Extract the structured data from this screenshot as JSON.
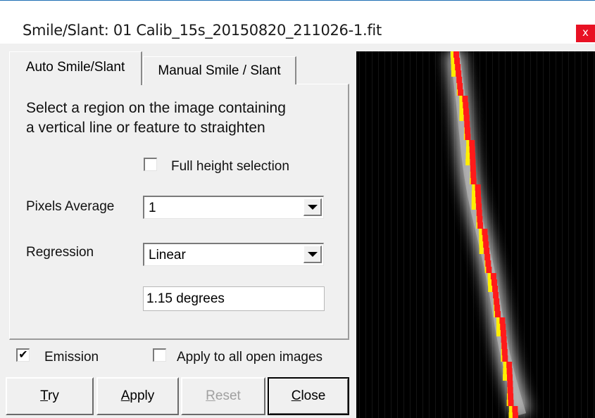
{
  "window": {
    "title": "Smile/Slant: 01 Calib_15s_20150820_211026-1.fit",
    "close_glyph": "x",
    "accent": "#e81123"
  },
  "tabs": [
    {
      "label": "Auto Smile/Slant",
      "active": true
    },
    {
      "label": "Manual Smile / Slant",
      "active": false
    }
  ],
  "instructions": {
    "line1": "Select a region on the image containing",
    "line2": "a vertical line or feature to straighten"
  },
  "full_height": {
    "label": "Full height selection",
    "checked": false
  },
  "pixels_average": {
    "label": "Pixels Average",
    "value": "1"
  },
  "regression": {
    "label": "Regression",
    "value": "Linear"
  },
  "angle": {
    "value": "1.15 degrees"
  },
  "emission": {
    "label": "Emission",
    "checked": true,
    "mark": "✔"
  },
  "apply_all": {
    "label": "Apply to all open images",
    "checked": false
  },
  "buttons": {
    "try": {
      "mnemonic": "T",
      "rest": "ry"
    },
    "apply": {
      "mnemonic": "A",
      "rest": "pply"
    },
    "reset": {
      "mnemonic": "R",
      "rest": "eset",
      "enabled": false
    },
    "close": {
      "mnemonic": "C",
      "rest": "lose"
    }
  },
  "preview": {
    "description_icon": "spectral-line-preview",
    "colors": {
      "background": "#000000",
      "glow": "#ffffff",
      "fit_red": "#ff1a1a",
      "fit_yellow": "#ffee00"
    }
  }
}
